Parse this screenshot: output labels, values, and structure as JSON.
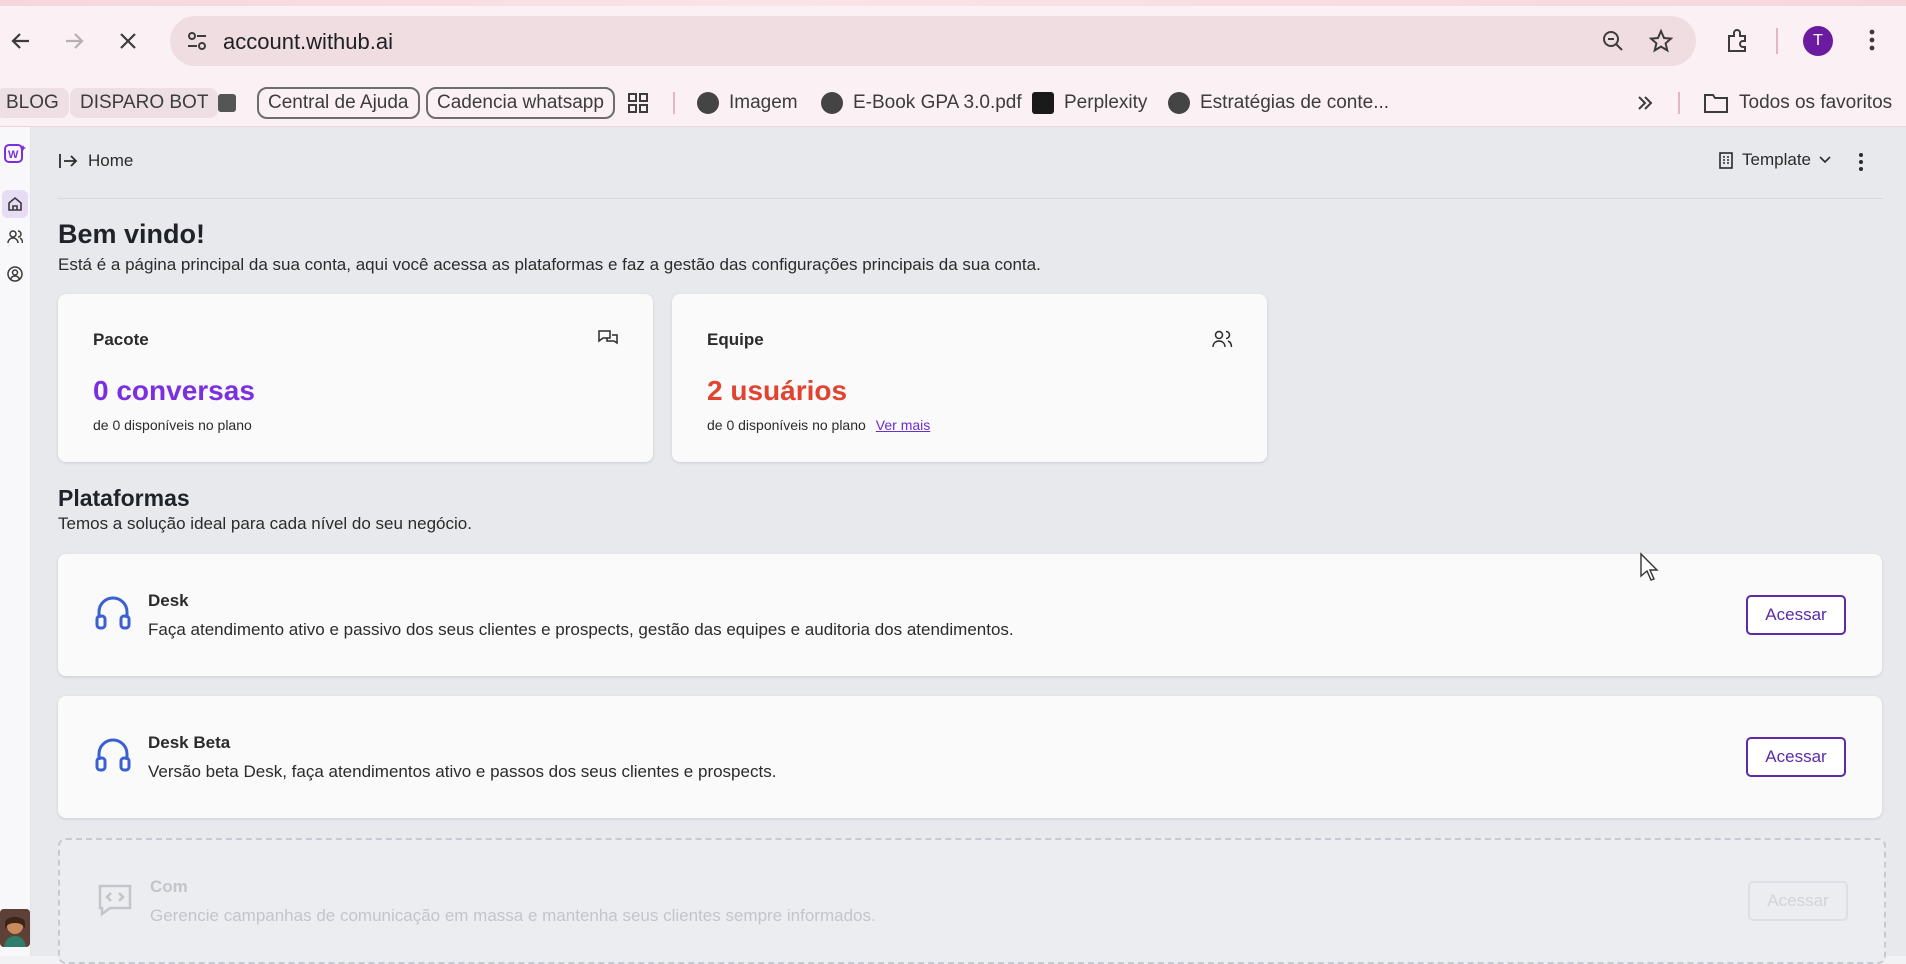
{
  "browser": {
    "url": "account.withub.ai",
    "profile_initial": "T",
    "bookmarks": [
      {
        "label": "BLOG",
        "style": "plain"
      },
      {
        "label": "DISPARO BOT",
        "style": "pill"
      },
      {
        "label": "Central de Ajuda",
        "style": "outlined"
      },
      {
        "label": "Cadencia whatsapp",
        "style": "outlined"
      },
      {
        "label": "Imagem",
        "icon": "globe-icon"
      },
      {
        "label": "E-Book GPA 3.0.pdf",
        "icon": "globe-icon"
      },
      {
        "label": "Perplexity",
        "icon": "perplexity-icon"
      },
      {
        "label": "Estratégias de conte...",
        "icon": "globe-icon"
      }
    ],
    "all_bookmarks_label": "Todos os favoritos"
  },
  "topbar": {
    "breadcrumb": "Home",
    "template_label": "Template"
  },
  "welcome": {
    "title": "Bem vindo!",
    "subtitle": "Está é a página principal da sua conta, aqui você acessa as plataformas e faz a gestão das configurações principais da sua conta."
  },
  "stats": {
    "package": {
      "label": "Pacote",
      "value": "0 conversas",
      "sub": "de 0 disponíveis no plano",
      "color": "#7b2fe0"
    },
    "team": {
      "label": "Equipe",
      "value": "2 usuários",
      "sub": "de 0 disponíveis no plano",
      "link": "Ver mais",
      "color": "#e0432f"
    }
  },
  "platforms": {
    "title": "Plataformas",
    "subtitle": "Temos a solução ideal para cada nível do seu negócio.",
    "items": [
      {
        "name": "Desk",
        "desc": "Faça atendimento ativo e passivo dos seus clientes e prospects, gestão das equipes e auditoria dos atendimentos.",
        "button": "Acessar",
        "icon": "headset-icon",
        "enabled": true
      },
      {
        "name": "Desk Beta",
        "desc": "Versão beta Desk, faça atendimentos ativo e passos dos seus clientes e prospects.",
        "button": "Acessar",
        "icon": "headset-icon",
        "enabled": true
      },
      {
        "name": "Com",
        "desc": "Gerencie campanhas de comunicação em massa e mantenha seus clientes sempre informados.",
        "button": "Acessar",
        "icon": "chat-code-icon",
        "enabled": false
      }
    ]
  },
  "colors": {
    "accent": "#5b2aa8",
    "headset_blue": "#3a5fd0"
  }
}
